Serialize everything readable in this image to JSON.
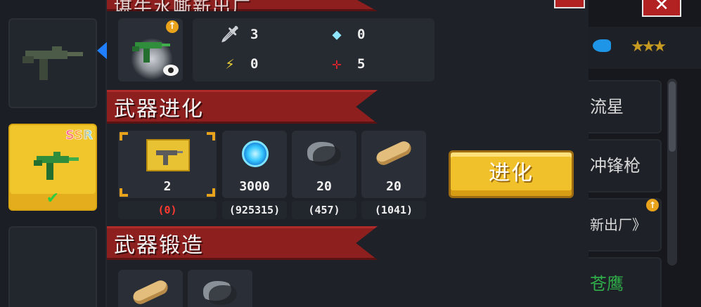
{
  "header": {
    "title": "堪牛水嘶新出厂"
  },
  "weapon": {
    "stats": [
      {
        "icon": "sword-icon",
        "value": "3"
      },
      {
        "icon": "gem-icon",
        "value": "0"
      },
      {
        "icon": "lightning-icon",
        "value": "0"
      },
      {
        "icon": "crosshair-icon",
        "value": "5"
      }
    ]
  },
  "evolution": {
    "title": "武器进化",
    "items": [
      {
        "icon": "weapon-card-icon",
        "required": "2",
        "owned": "(0)"
      },
      {
        "icon": "blue-orb-icon",
        "required": "3000",
        "owned": "(925315)"
      },
      {
        "icon": "ore-icon",
        "required": "20",
        "owned": "(457)"
      },
      {
        "icon": "log-icon",
        "required": "20",
        "owned": "(1041)"
      }
    ],
    "button_label": "进化"
  },
  "forge": {
    "title": "武器锻造",
    "items": [
      {
        "icon": "log-icon"
      },
      {
        "icon": "ore-icon"
      }
    ]
  },
  "left_list": {
    "badge": "SSR"
  },
  "right_list": {
    "items": [
      "流星",
      "冲锋枪",
      "新出厂》",
      "苍鹰"
    ]
  },
  "colors": {
    "banner": "#8e1f1f",
    "accent": "#f1c12c",
    "owned_insufficient": "#ff3b30"
  }
}
